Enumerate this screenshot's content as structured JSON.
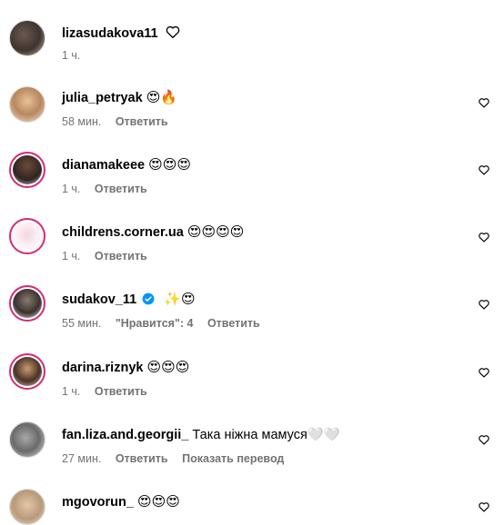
{
  "post": {
    "username": "lizasudakova11",
    "time": "1 ч.",
    "like_icon": "heart-outline-icon"
  },
  "labels": {
    "reply": "Ответить",
    "translate": "Показать перевод"
  },
  "comments": [
    {
      "username": "julia_petryak",
      "text": "😍🔥",
      "time": "58 мин.",
      "likes": ""
    },
    {
      "username": "dianamakeee",
      "text": "😍😍😍",
      "time": "1 ч.",
      "likes": ""
    },
    {
      "username": "childrens.corner.ua",
      "text": "😍😍😍😍",
      "time": "1 ч.",
      "likes": ""
    },
    {
      "username": "sudakov_11",
      "text": "✨😍",
      "time": "55 мин.",
      "likes": "\"Нравится\": 4",
      "verified": true
    },
    {
      "username": "darina.riznyk",
      "text": "😍😍😍",
      "time": "1 ч.",
      "likes": ""
    },
    {
      "username": "fan.liza.and.georgii_",
      "text": "Така ніжна мамуся🤍🤍",
      "time": "27 мин.",
      "likes": "",
      "translate": true
    },
    {
      "username": "mgovorun_",
      "text": "😍😍😍",
      "time": "",
      "likes": ""
    }
  ],
  "colors": {
    "meta_text": "#737373",
    "story_ring": "#d62976",
    "verified": "#0095f6"
  }
}
